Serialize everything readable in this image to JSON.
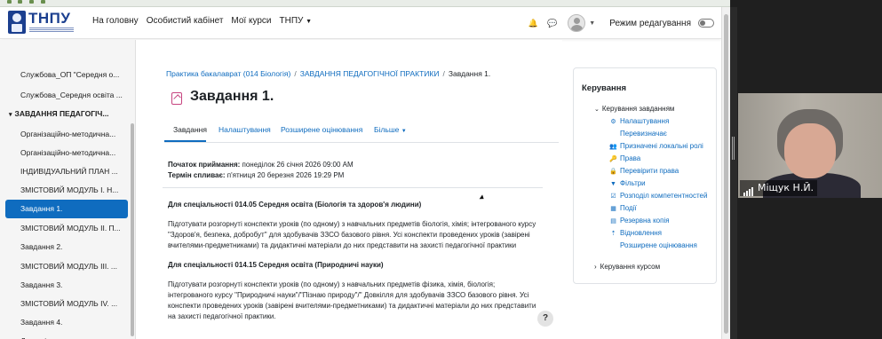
{
  "navbar": {
    "logo_text": "ТНПУ",
    "links": [
      "На головну",
      "Особистий кабінет",
      "Мої курси",
      "ТНПУ"
    ],
    "edit_mode_label": "Режим редагування"
  },
  "drawer": {
    "items": [
      {
        "label": "Службова_ОП \"Середня о...",
        "type": "item"
      },
      {
        "label": "Службова_Середня освіта ...",
        "type": "item"
      },
      {
        "label": "ЗАВДАННЯ ПЕДАГОГІЧ...",
        "type": "section"
      },
      {
        "label": "Організаційно-методична...",
        "type": "item"
      },
      {
        "label": "Організаційно-методична...",
        "type": "item"
      },
      {
        "label": "ІНДИВІДУАЛЬНИЙ ПЛАН ...",
        "type": "item"
      },
      {
        "label": "ЗМІСТОВИЙ МОДУЛЬ І. Н...",
        "type": "item"
      },
      {
        "label": "Завдання 1.",
        "type": "active"
      },
      {
        "label": "ЗМІСТОВИЙ МОДУЛЬ ІІ. П...",
        "type": "item"
      },
      {
        "label": "Завдання 2.",
        "type": "item"
      },
      {
        "label": "ЗМІСТОВИЙ МОДУЛЬ ІІІ. ...",
        "type": "item"
      },
      {
        "label": "Завдання 3.",
        "type": "item"
      },
      {
        "label": "ЗМІСТОВИЙ МОДУЛЬ IV. ...",
        "type": "item"
      },
      {
        "label": "Завдання 4.",
        "type": "item"
      },
      {
        "label": "Для оцінювання результат...",
        "type": "item"
      }
    ]
  },
  "breadcrumb": {
    "items": [
      "Практика бакалаврат (014 Біологія)",
      "ЗАВДАННЯ ПЕДАГОГІЧНОЇ ПРАКТИКИ",
      "Завдання 1."
    ]
  },
  "page": {
    "title": "Завдання 1.",
    "tabs": [
      "Завдання",
      "Налаштування",
      "Розширене оцінювання",
      "Більше"
    ]
  },
  "dates": {
    "opened_label": "Початок приймання:",
    "opened_value": "понеділок 26 січня 2026 09:00 AM",
    "due_label": "Термін спливає:",
    "due_value": "п'ятниця 20 березня 2026 19:29 PM"
  },
  "description": {
    "heading1": "Для спеціальності 014.05 Середня освіта (Біологія та здоров'я людини)",
    "para1": "Підготувати розгорнуті конспекти уроків (по одному) з навчальних предметів біологія, хімія; інтегрованого курсу \"Здоров'я, безпека, добробут\" для здобувачів ЗЗСО базового рівня. Усі конспекти проведених уроків (завірені вчителями-предметниками) та дидактичні матеріали до них представити на захисті педагогічної практики",
    "heading2": "Для спеціальності 014.15 Середня освіта (Природничі науки)",
    "para2": "Підготувати розгорнуті конспекти уроків (по одному) з навчальних предметів фізика, хімія, біологія; інтегрованого курсу \"Природничі науки\"/\"Пізнаю природу\"/\" Довкілля для здобувачів ЗЗСО базового рівня. Усі конспекти проведених уроків (завірені вчителями-предметниками) та дидактичні матеріали до них представити на захисті педагогічної практики."
  },
  "help_label": "?",
  "admin_block": {
    "title": "Керування",
    "node": "Керування завданням",
    "items": [
      {
        "label": "Налаштування",
        "icon": "gear-icon",
        "glyph": "⚙"
      },
      {
        "label": "Перевизначає",
        "icon": "",
        "glyph": ""
      },
      {
        "label": "Призначені локальні ролі",
        "icon": "users-icon",
        "glyph": "👥"
      },
      {
        "label": "Права",
        "icon": "key-icon",
        "glyph": "🔑"
      },
      {
        "label": "Перевірити права",
        "icon": "lock-icon",
        "glyph": "🔒"
      },
      {
        "label": "Фільтри",
        "icon": "filter-icon",
        "glyph": "▼"
      },
      {
        "label": "Розподіл компетентностей",
        "icon": "checkbox-icon",
        "glyph": "☑"
      },
      {
        "label": "Події",
        "icon": "calendar-icon",
        "glyph": "▦"
      },
      {
        "label": "Резервна копія",
        "icon": "archive-icon",
        "glyph": "▤"
      },
      {
        "label": "Відновлення",
        "icon": "upload-icon",
        "glyph": "⇡"
      },
      {
        "label": "Розширене оцінювання",
        "icon": "",
        "glyph": ""
      }
    ],
    "footer": "Керування курсом"
  },
  "video": {
    "participant_name": "Міщук Н.Й."
  }
}
